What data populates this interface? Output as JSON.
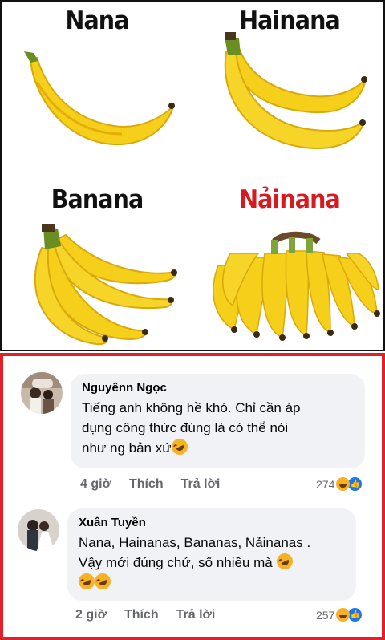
{
  "meme": {
    "captions": {
      "top_left": "Nana",
      "top_right": "Hainana",
      "bottom_left": "Banana",
      "bottom_right": "Nảinana"
    },
    "colors": {
      "banana": "#f5cf1a",
      "banana_shade": "#e3ad0a",
      "stem": "#6b8e23",
      "tip": "#3a2a12",
      "red_caption": "#d71920"
    }
  },
  "comments": [
    {
      "author": "Nguyênn Ngọc",
      "lines": [
        "Tiếng anh không hề khó. Chỉ cần áp",
        "dụng công thức đúng là có thể nói",
        "như ng bản xứ"
      ],
      "time": "4 giờ",
      "like_label": "Thích",
      "reply_label": "Trả lời",
      "reaction_count": "274",
      "reactions": [
        "haha-icon",
        "like-icon"
      ]
    },
    {
      "author": "Xuân Tuyền",
      "lines": [
        "Nana, Hainanas, Bananas, Nảinanas .",
        "Vậy mới đúng chứ, số nhiều mà"
      ],
      "time": "2 giờ",
      "like_label": "Thích",
      "reply_label": "Trả lời",
      "reaction_count": "257",
      "reactions": [
        "haha-icon",
        "like-icon"
      ]
    }
  ],
  "frame_color": "#e0202a"
}
